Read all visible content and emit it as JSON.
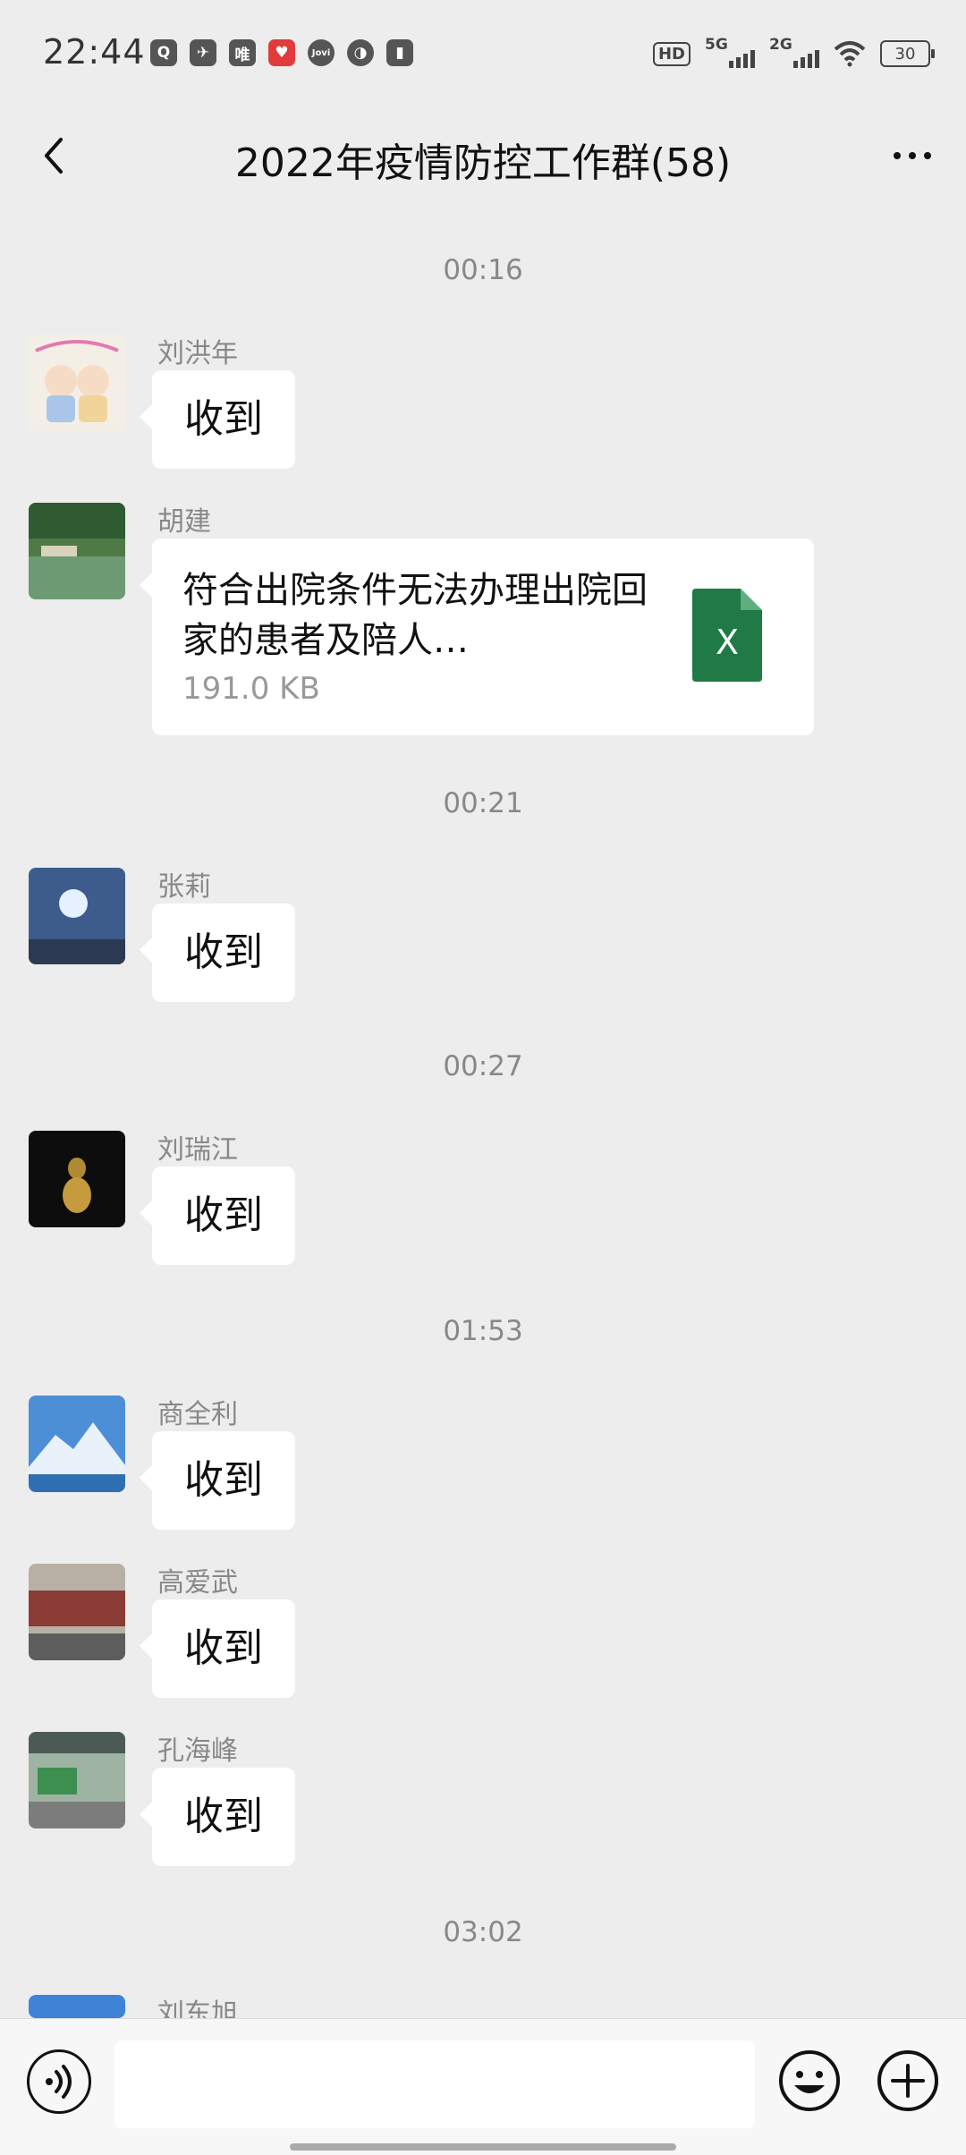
{
  "status_bar": {
    "time": "22:44",
    "app_icons": [
      "Q",
      "✈",
      "唯",
      "♥",
      "Jovi",
      "◑",
      "▮"
    ],
    "hd": "HD",
    "net1": "5G",
    "net2": "2G",
    "battery": "30"
  },
  "nav": {
    "title": "2022年疫情防控工作群(58)"
  },
  "chat": {
    "time_1": "00:16",
    "time_2": "00:21",
    "time_3": "00:27",
    "time_4": "01:53",
    "time_5": "03:02",
    "messages": [
      {
        "sender": "刘洪年",
        "text": "收到"
      },
      {
        "sender": "胡建",
        "file_name": "符合出院条件无法办理出院回家的患者及陪人…",
        "file_size": "191.0  KB",
        "file_icon": "X"
      },
      {
        "sender": "张莉",
        "text": "收到"
      },
      {
        "sender": "刘瑞江",
        "text": "收到"
      },
      {
        "sender": "商全利",
        "text": "收到"
      },
      {
        "sender": "高爱武",
        "text": "收到"
      },
      {
        "sender": "孔海峰",
        "text": "收到"
      },
      {
        "sender": "刘东旭"
      }
    ]
  }
}
